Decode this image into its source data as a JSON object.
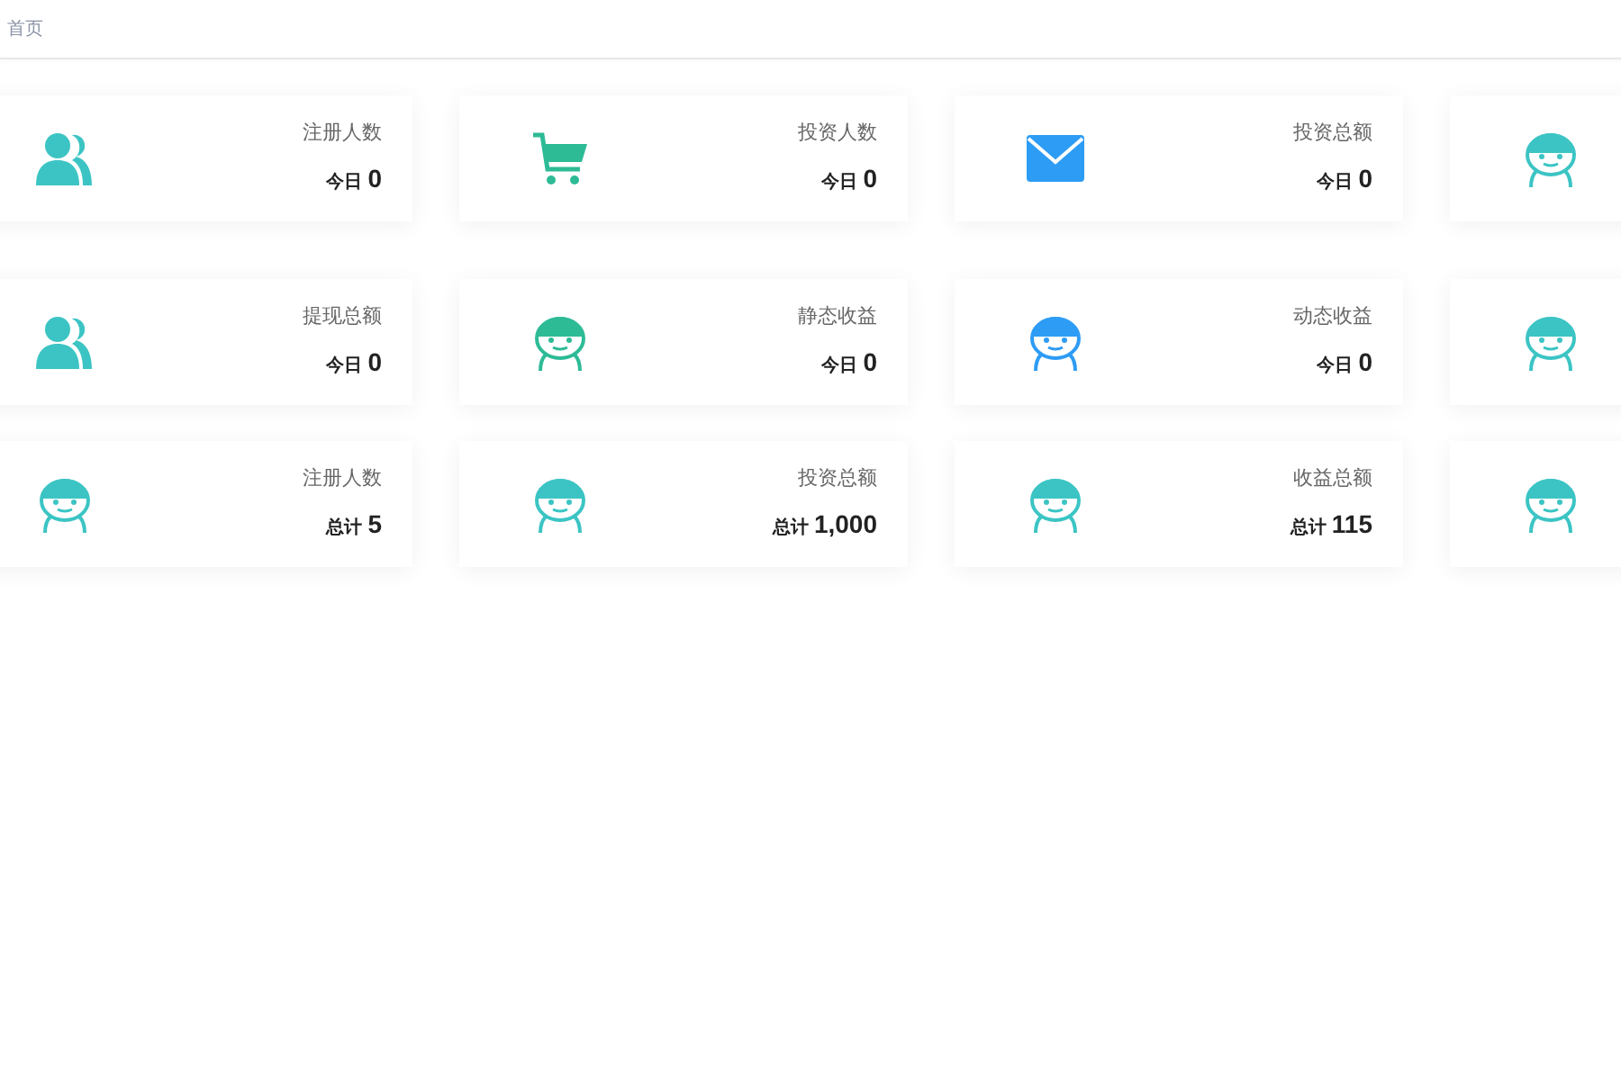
{
  "breadcrumb": "首页",
  "rows": [
    {
      "cards": [
        {
          "kind": "users",
          "color": "#3cc4c4",
          "title": "注册人数",
          "period": "今日",
          "value": "0"
        },
        {
          "kind": "cart",
          "color": "#2dbb96",
          "title": "投资人数",
          "period": "今日",
          "value": "0"
        },
        {
          "kind": "mail",
          "color": "#2d9cf5",
          "title": "投资总额",
          "period": "今日",
          "value": "0"
        },
        {
          "kind": "face",
          "color": "#3cc4c4"
        }
      ]
    },
    {
      "cards": [
        {
          "kind": "users",
          "color": "#3cc4c4",
          "title": "提现总额",
          "period": "今日",
          "value": "0"
        },
        {
          "kind": "face",
          "color": "#2dbb96",
          "title": "静态收益",
          "period": "今日",
          "value": "0"
        },
        {
          "kind": "face",
          "color": "#2d9cf5",
          "title": "动态收益",
          "period": "今日",
          "value": "0"
        },
        {
          "kind": "face",
          "color": "#3cc4c4"
        }
      ]
    },
    {
      "cards": [
        {
          "kind": "face",
          "color": "#3cc4c4",
          "title": "注册人数",
          "period": "总计",
          "value": "5"
        },
        {
          "kind": "face",
          "color": "#3cc4c4",
          "title": "投资总额",
          "period": "总计",
          "value": "1,000"
        },
        {
          "kind": "face",
          "color": "#3cc4c4",
          "title": "收益总额",
          "period": "总计",
          "value": "115"
        },
        {
          "kind": "face",
          "color": "#3cc4c4"
        }
      ]
    }
  ]
}
